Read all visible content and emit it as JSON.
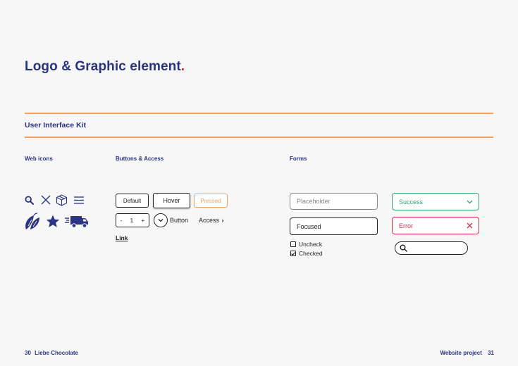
{
  "header": {
    "title": "Logo & Graphic element",
    "title_dot": ".",
    "section_title": "User Interface Kit"
  },
  "columns": {
    "web_icons": "Web icons",
    "buttons": "Buttons & Access",
    "forms": "Forms"
  },
  "icons": [
    "search-icon",
    "close-icon",
    "box-icon",
    "menu-icon",
    "cocoa-pod-icon",
    "star-icon",
    "delivery-truck-icon"
  ],
  "buttons": {
    "default": "Default",
    "hover": "Hover",
    "pressed": "Pressed",
    "stepper_minus": "-",
    "stepper_value": "1",
    "stepper_plus": "+",
    "button_label": "Button",
    "access_label": "Access",
    "access_chevron": "›",
    "link": "Link"
  },
  "forms": {
    "placeholder": "Placeholder",
    "focused": "Focused",
    "success": "Success",
    "error": "Error",
    "uncheck": "Uncheck",
    "checked": "Checked"
  },
  "footer": {
    "left_page": "30",
    "left_brand": "Liebe Chocolate",
    "right_label": "Website project",
    "right_page": "31"
  },
  "colors": {
    "primary": "#2a3480",
    "accent_dot": "#e31e24",
    "rule": "#f0a060",
    "success": "#2fa66e",
    "error": "#e0284a"
  }
}
